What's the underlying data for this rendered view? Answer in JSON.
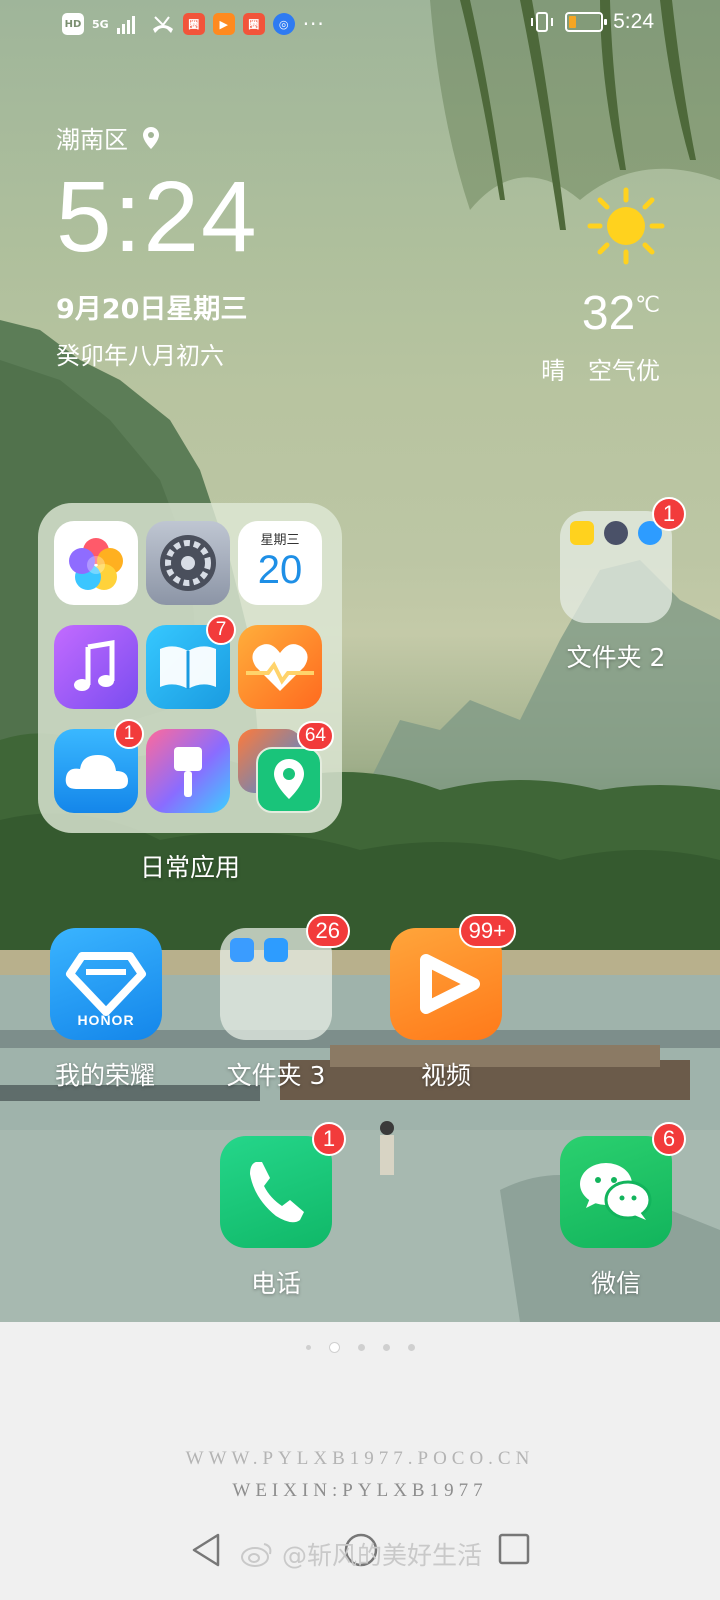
{
  "status_bar": {
    "left_labels": [
      "HD",
      "5G"
    ],
    "time": "5:24",
    "icons": [
      "signal-icon",
      "missed-call-icon",
      "app-notification-icon",
      "video-notification-icon",
      "app-notification-icon",
      "browser-notification-icon",
      "more-icon",
      "vibrate-icon",
      "battery-icon"
    ]
  },
  "clock_widget": {
    "location": "潮南区",
    "time": "5:24",
    "date": "9月20日星期三",
    "lunar_date": "癸卯年八月初六"
  },
  "weather_widget": {
    "temperature": "32",
    "unit": "℃",
    "condition": "晴",
    "air_quality": "空气优",
    "icon": "sun-icon"
  },
  "folders": {
    "daily": {
      "label": "日常应用",
      "apps": [
        {
          "name": "gallery-icon",
          "badge": ""
        },
        {
          "name": "settings-icon",
          "badge": ""
        },
        {
          "name": "calendar-icon",
          "badge": "",
          "weekday": "星期三",
          "day": "20"
        },
        {
          "name": "music-icon",
          "badge": ""
        },
        {
          "name": "books-icon",
          "badge": "7"
        },
        {
          "name": "health-icon",
          "badge": ""
        },
        {
          "name": "cloud-icon",
          "badge": "1"
        },
        {
          "name": "themes-icon",
          "badge": ""
        },
        {
          "name": "location-icon",
          "badge": "64"
        }
      ]
    },
    "folder2": {
      "label": "文件夹 2",
      "badge": "1"
    },
    "folder3": {
      "label": "文件夹 3",
      "badge": "26"
    }
  },
  "apps": {
    "honor": {
      "label": "我的荣耀",
      "logo_text": "HONOR",
      "badge": ""
    },
    "video": {
      "label": "视频",
      "badge": "99+"
    },
    "phone": {
      "label": "电话",
      "badge": "1"
    },
    "wechat": {
      "label": "微信",
      "badge": "6"
    }
  },
  "page_indicator": {
    "pages": 5,
    "active": 2
  },
  "watermark": {
    "line1": "WWW.PYLXB1977.POCO.CN",
    "line2": "WEIXIN:PYLXB1977",
    "weibo": "@斩风的美好生活"
  },
  "colors": {
    "badge": "#f23b3b",
    "honor": "#1e9bf0",
    "video": "#ff8a1f",
    "phone": "#16c979",
    "wechat": "#15c26b"
  }
}
